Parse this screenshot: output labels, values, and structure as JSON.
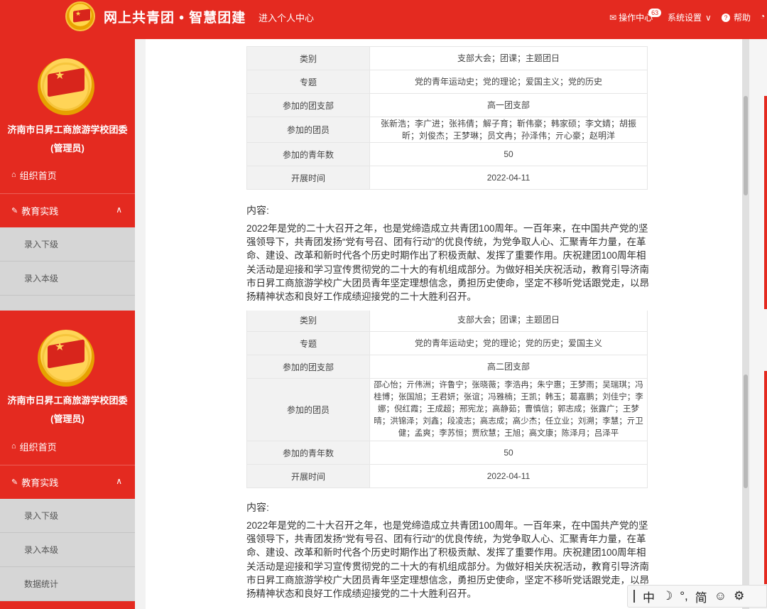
{
  "header": {
    "site_title": "网上共青团 • 智慧团建",
    "center_link": "进入个人中心",
    "ops_center": "操作中心",
    "ops_badge": "63",
    "settings": "系统设置",
    "help": "帮助"
  },
  "sidebar": {
    "org_name": "济南市日昇工商旅游学校团委",
    "role": "(管理员)",
    "home": "组织首页",
    "group": "教育实践",
    "sub_items": [
      "录入下级",
      "录入本级",
      "数据统计"
    ]
  },
  "records": [
    {
      "rows": [
        {
          "key": "类别",
          "value": "支部大会；团课；主题团日"
        },
        {
          "key": "专题",
          "value": "党的青年运动史；党的理论；爱国主义；党的历史"
        },
        {
          "key": "参加的团支部",
          "value": "高一团支部"
        },
        {
          "key": "参加的团员",
          "value": "张新浩；李广进；张祎倩；解子育；靳伟豪；韩家硕；李文婧；胡振昕；刘俊杰；王梦琳；员文冉；孙泽伟；亓心豪；赵明洋"
        },
        {
          "key": "参加的青年数",
          "value": "50"
        },
        {
          "key": "开展时间",
          "value": "2022-04-11"
        }
      ],
      "content_label": "内容:",
      "content": "2022年是党的二十大召开之年，也是党缔造成立共青团100周年。一百年来，在中国共产党的坚强领导下，共青团发扬“党有号召、团有行动”的优良传统，为党争取人心、汇聚青年力量，在革命、建设、改革和新时代各个历史时期作出了积极贡献、发挥了重要作用。庆祝建团100周年相关活动是迎接和学习宣传贯彻党的二十大的有机组成部分。为做好相关庆祝活动，教育引导济南市日昇工商旅游学校广大团员青年坚定理想信念，勇担历史使命，坚定不移听党话跟党走，以昂扬精神状态和良好工作成绩迎接党的二十大胜利召开。"
    },
    {
      "rows": [
        {
          "key": "类别",
          "value": "支部大会；团课；主题团日"
        },
        {
          "key": "专题",
          "value": "党的青年运动史；党的理论；党的历史；爱国主义"
        },
        {
          "key": "参加的团支部",
          "value": "高二团支部"
        },
        {
          "key": "参加的团员",
          "value": "邵心怡；亓伟洲；许鲁宁；张晓薇；李浩冉；朱宁惠；王梦雨；吴瑞琪；冯桂博；张国旭；王君妍；张谊；冯雅楠；王凯；韩玉；葛嘉鹏；刘佳宁；李娜；倪红霞；王成超；邢宪龙；高静茹；曹慎信；郭志成；张露广；王梦晴；洪锦泽；刘鑫；段凌志；高志成；高少杰；任立业；刘溯；李慧；亓卫健；孟爽；李苏恒；贾欣慧；王旭；高文康；陈泽月；吕泽平"
        },
        {
          "key": "参加的青年数",
          "value": "50"
        },
        {
          "key": "开展时间",
          "value": "2022-04-11"
        }
      ],
      "content_label": "内容:",
      "content": "2022年是党的二十大召开之年，也是党缔造成立共青团100周年。一百年来，在中国共产党的坚强领导下，共青团发扬“党有号召、团有行动”的优良传统，为党争取人心、汇聚青年力量，在革命、建设、改革和新时代各个历史时期作出了积极贡献、发挥了重要作用。庆祝建团100周年相关活动是迎接和学习宣传贯彻党的二十大的有机组成部分。为做好相关庆祝活动，教育引导济南市日昇工商旅游学校广大团员青年坚定理想信念，勇担历史使命，坚定不移听党话跟党走，以昂扬精神状态和良好工作成绩迎接党的二十大胜利召开。"
    }
  ],
  "ime": {
    "lang": "中",
    "moon": "☽",
    "punct": "°,",
    "simp": "简",
    "emoji": "☺",
    "gear": "⚙"
  }
}
